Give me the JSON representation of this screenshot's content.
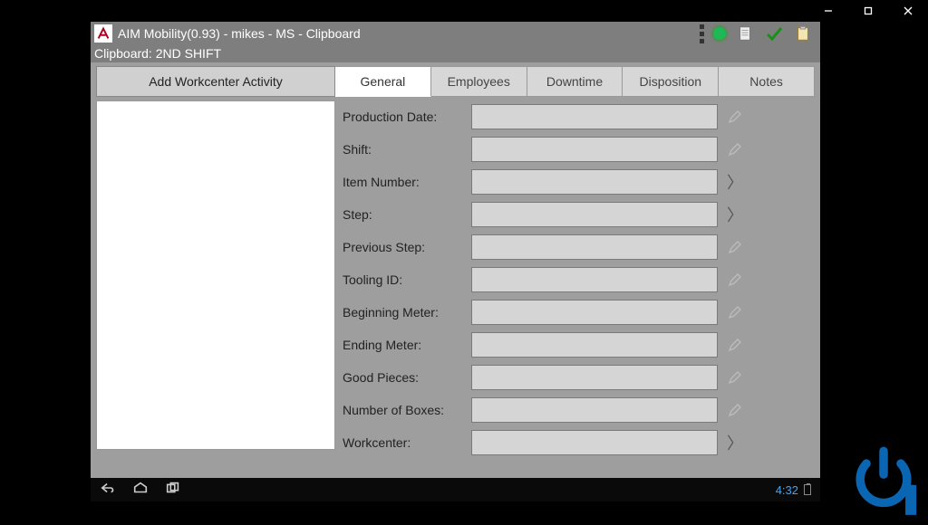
{
  "app": {
    "title": "AIM Mobility(0.93) - mikes - MS - Clipboard"
  },
  "clipboard_bar": "Clipboard: 2ND SHIFT",
  "toolbar": {
    "add_button": "Add Workcenter Activity"
  },
  "tabs": [
    {
      "label": "General",
      "active": true
    },
    {
      "label": "Employees",
      "active": false
    },
    {
      "label": "Downtime",
      "active": false
    },
    {
      "label": "Disposition",
      "active": false
    },
    {
      "label": "Notes",
      "active": false
    }
  ],
  "form_fields": [
    {
      "label": "Production Date:",
      "value": "",
      "picker": "edit"
    },
    {
      "label": "Shift:",
      "value": "",
      "picker": "edit"
    },
    {
      "label": "Item Number:",
      "value": "",
      "picker": "chevron"
    },
    {
      "label": "Step:",
      "value": "",
      "picker": "chevron"
    },
    {
      "label": "Previous Step:",
      "value": "",
      "picker": "edit"
    },
    {
      "label": "Tooling ID:",
      "value": "",
      "picker": "edit"
    },
    {
      "label": "Beginning Meter:",
      "value": "",
      "picker": "edit"
    },
    {
      "label": "Ending Meter:",
      "value": "",
      "picker": "edit"
    },
    {
      "label": "Good Pieces:",
      "value": "",
      "picker": "edit"
    },
    {
      "label": "Number of Boxes:",
      "value": "",
      "picker": "edit"
    },
    {
      "label": "Workcenter:",
      "value": "",
      "picker": "chevron"
    }
  ],
  "android_nav": {
    "clock": "4:32"
  },
  "window_controls": {
    "minimize": "minimize",
    "maximize": "maximize",
    "close": "close"
  }
}
